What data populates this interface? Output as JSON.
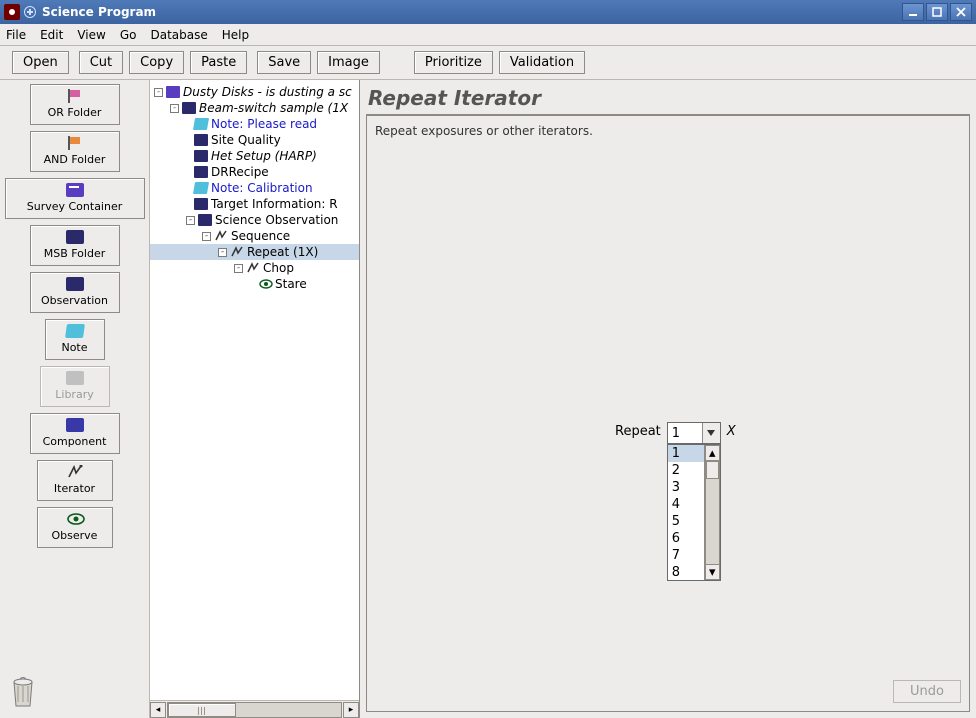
{
  "window": {
    "title": "Science Program"
  },
  "menu": {
    "items": [
      "File",
      "Edit",
      "View",
      "Go",
      "Database",
      "Help"
    ]
  },
  "toolbar": {
    "open": "Open",
    "cut": "Cut",
    "copy": "Copy",
    "paste": "Paste",
    "save": "Save",
    "image": "Image",
    "prioritize": "Prioritize",
    "validation": "Validation"
  },
  "palette": {
    "or_folder": "OR Folder",
    "and_folder": "AND Folder",
    "survey_container": "Survey Container",
    "msb_folder": "MSB Folder",
    "observation": "Observation",
    "note": "Note",
    "library": "Library",
    "component": "Component",
    "iterator": "Iterator",
    "observe": "Observe"
  },
  "tree": {
    "root": "Dusty Disks - is dusting a sc",
    "beam": "Beam-switch sample (1X",
    "note1": "Note: Please read",
    "site_quality": "Site Quality",
    "het_setup": "Het Setup (HARP)",
    "drrecipe": "DRRecipe",
    "note2": "Note: Calibration",
    "target_info": "Target Information: R",
    "science_obs": "Science Observation",
    "sequence": "Sequence",
    "repeat": "Repeat (1X)",
    "chop": "Chop",
    "stare": "Stare"
  },
  "panel": {
    "title": "Repeat Iterator",
    "description": "Repeat exposures or other iterators.",
    "repeat_label": "Repeat",
    "repeat_value": "1",
    "repeat_suffix": "X",
    "options": [
      "1",
      "2",
      "3",
      "4",
      "5",
      "6",
      "7",
      "8"
    ],
    "undo": "Undo"
  }
}
